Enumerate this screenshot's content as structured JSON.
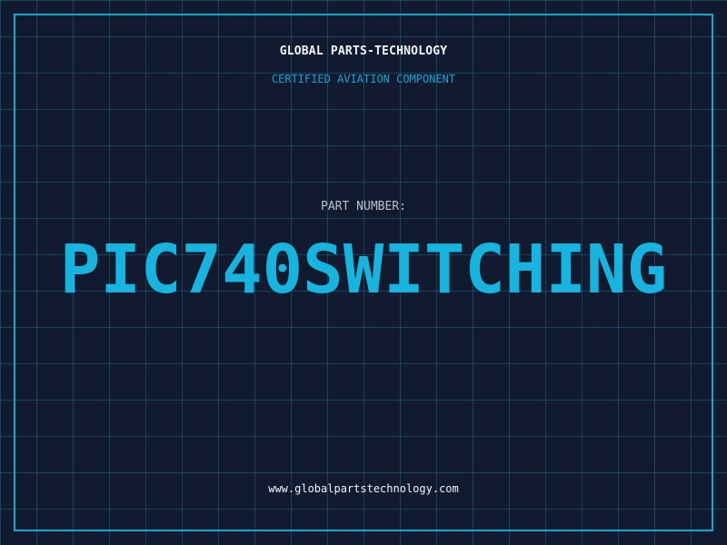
{
  "header": {
    "company": "GLOBAL PARTS-TECHNOLOGY",
    "subtitle": "CERTIFIED AVIATION COMPONENT"
  },
  "part": {
    "label": "PART NUMBER:",
    "number": "PIC740SWITCHING"
  },
  "footer": {
    "website": "www.globalpartstechnology.com"
  },
  "colors": {
    "background": "#111a2e",
    "grid": "#1e7896",
    "frame": "#14a7cf",
    "accent": "#16b4de",
    "text": "#f1f4f8"
  }
}
